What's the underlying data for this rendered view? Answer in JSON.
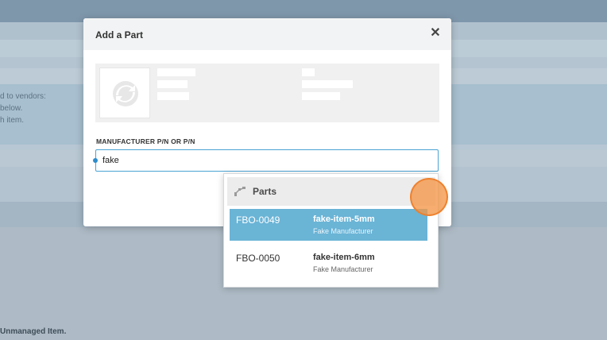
{
  "background": {
    "info_lines": [
      "d to vendors:",
      "below.",
      "h item."
    ],
    "footer_text": "Unmanaged Item."
  },
  "modal": {
    "title": "Add a Part",
    "close_glyph": "✕",
    "field": {
      "label": "MANUFACTURER P/N OR P/N",
      "value": "fake"
    }
  },
  "dropdown": {
    "section_label": "Parts",
    "section_icon": "parts-icon",
    "items": [
      {
        "pn": "FBO-0049",
        "name": "fake-item-5mm",
        "manufacturer": "Fake Manufacturer",
        "selected": true
      },
      {
        "pn": "FBO-0050",
        "name": "fake-item-6mm",
        "manufacturer": "Fake Manufacturer",
        "selected": false
      }
    ]
  },
  "colors": {
    "accent": "#4aa3d3",
    "selected_row": "#6ab4d6",
    "click_indicator": "#f49646"
  }
}
